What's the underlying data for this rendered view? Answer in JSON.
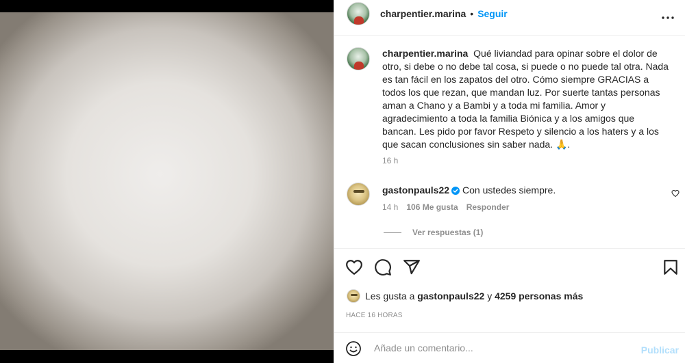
{
  "post": {
    "username": "charpentier.marina",
    "follow_label": "Seguir",
    "separator": "•",
    "caption_username": "charpentier.marina",
    "caption_text": "Qué liviandad para opinar sobre el dolor de otro, si debe o no debe tal cosa, si puede o no puede tal otra. Nada es tan fácil en los zapatos del otro. Cómo siempre GRACIAS a todos los que rezan, que mandan luz. Por suerte tantas personas aman a Chano y a Bambi y a toda mi familia. Amor y agradecimiento a toda la familia Biónica y a los amigos que bancan. Les pido por favor Respeto y silencio a los haters y a los que sacan conclusiones sin saber nada. 🙏.",
    "caption_time": "16 h"
  },
  "comment": {
    "username": "gastonpauls22",
    "text": "Con ustedes siempre.",
    "time": "14 h",
    "likes": "106 Me gusta",
    "reply_label": "Responder",
    "view_replies": "Ver respuestas (1)"
  },
  "likes": {
    "prefix": "Les gusta a",
    "user": "gastonpauls22",
    "conjunction": "y",
    "others": "4259 personas más"
  },
  "timestamp": "HACE 16 HORAS",
  "add_comment": {
    "placeholder": "Añade un comentario...",
    "publish_label": "Publicar"
  },
  "icons": {
    "more": "more-icon",
    "verified": "verified-badge-icon",
    "like": "heart-icon",
    "comment": "comment-icon",
    "share": "share-icon",
    "save": "bookmark-icon",
    "emoji": "emoji-icon"
  },
  "colors": {
    "accent": "#0095f6",
    "publish_disabled": "#b2dffc",
    "secondary_text": "#8e8e8e"
  }
}
